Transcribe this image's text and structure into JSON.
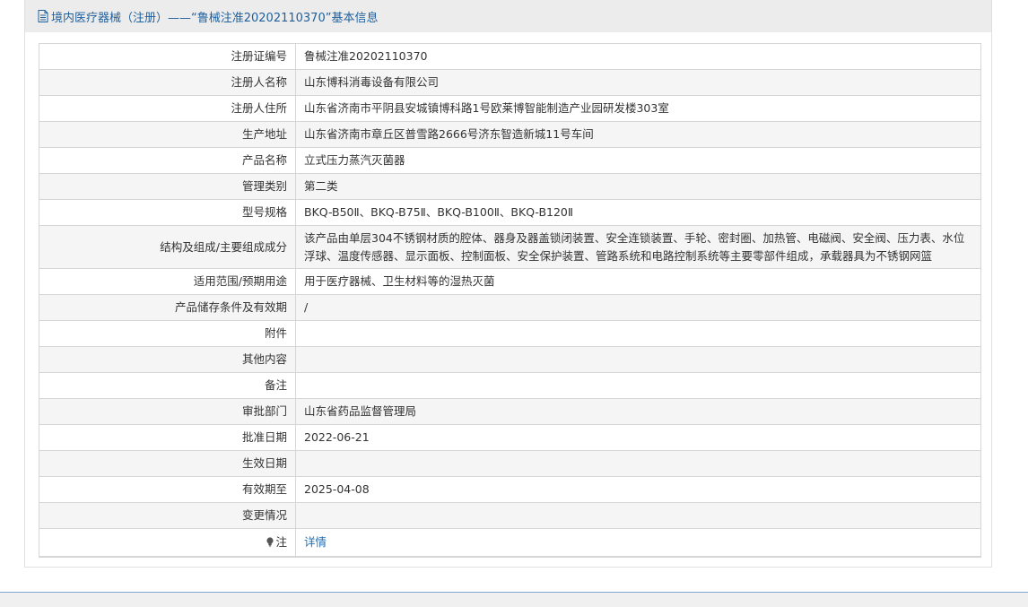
{
  "header": {
    "title": "境内医疗器械（注册）——“鲁械注准20202110370”基本信息"
  },
  "rows": [
    {
      "label": "注册证编号",
      "value": "鲁械注准20202110370"
    },
    {
      "label": "注册人名称",
      "value": "山东博科消毒设备有限公司"
    },
    {
      "label": "注册人住所",
      "value": "山东省济南市平阴县安城镇博科路1号欧莱博智能制造产业园研发楼303室"
    },
    {
      "label": "生产地址",
      "value": "山东省济南市章丘区普雪路2666号济东智造新城11号车间"
    },
    {
      "label": "产品名称",
      "value": "立式压力蒸汽灭菌器"
    },
    {
      "label": "管理类别",
      "value": "第二类"
    },
    {
      "label": "型号规格",
      "value": "BKQ-B50Ⅱ、BKQ-B75Ⅱ、BKQ-B100Ⅱ、BKQ-B120Ⅱ"
    },
    {
      "label": "结构及组成/主要组成成分",
      "value": "该产品由单层304不锈钢材质的腔体、器身及器盖锁闭装置、安全连锁装置、手轮、密封圈、加热管、电磁阀、安全阀、压力表、水位浮球、温度传感器、显示面板、控制面板、安全保护装置、管路系统和电路控制系统等主要零部件组成，承载器具为不锈钢网篮"
    },
    {
      "label": "适用范围/预期用途",
      "value": "用于医疗器械、卫生材料等的湿热灭菌"
    },
    {
      "label": "产品储存条件及有效期",
      "value": "/"
    },
    {
      "label": "附件",
      "value": ""
    },
    {
      "label": "其他内容",
      "value": ""
    },
    {
      "label": "备注",
      "value": ""
    },
    {
      "label": "审批部门",
      "value": "山东省药品监督管理局"
    },
    {
      "label": "批准日期",
      "value": "2022-06-21"
    },
    {
      "label": "生效日期",
      "value": ""
    },
    {
      "label": "有效期至",
      "value": "2025-04-08"
    },
    {
      "label": "变更情况",
      "value": ""
    }
  ],
  "note": {
    "label": "注",
    "link_text": "详情",
    "icon": "lightbulb-icon"
  },
  "colors": {
    "header_text": "#1f5f9c",
    "link": "#1f6fb5",
    "border": "#d6d6d6"
  }
}
